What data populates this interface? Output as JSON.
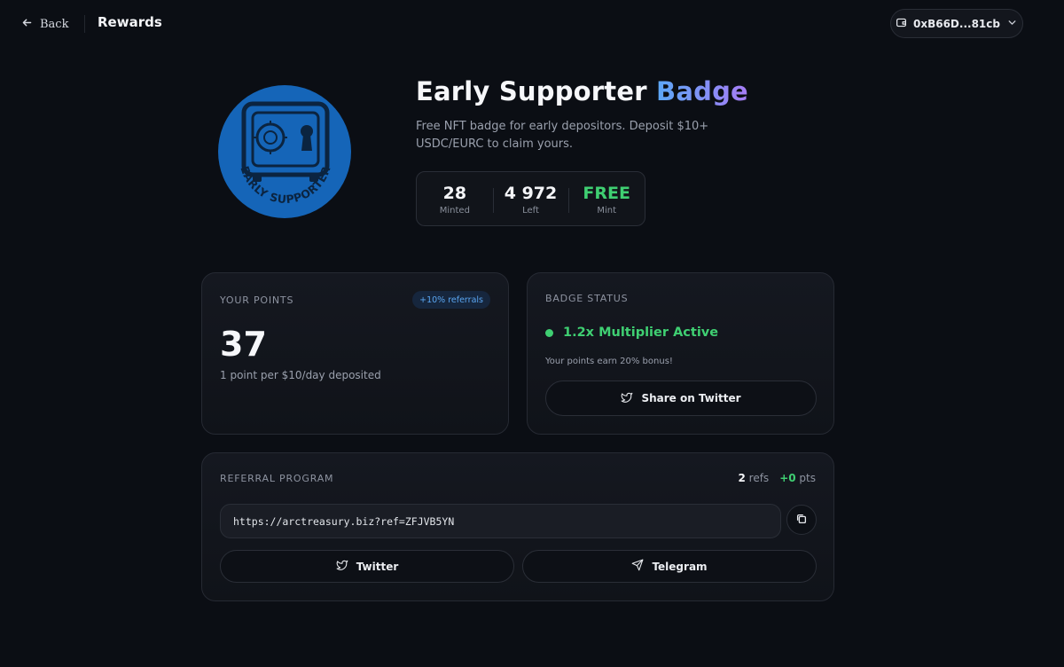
{
  "header": {
    "back_label": "Back",
    "title": "Rewards",
    "wallet_address": "0xB66D...81cb"
  },
  "hero": {
    "title_main": "Early Supporter",
    "title_accent": "Badge",
    "description": "Free NFT badge for early depositors. Deposit $10+ USDC/EURC to claim yours.",
    "badge_text": "EARLY SUPPORTER",
    "stats": [
      {
        "value": "28",
        "label": "Minted"
      },
      {
        "value": "4 972",
        "label": "Left"
      },
      {
        "value": "FREE",
        "label": "Mint"
      }
    ]
  },
  "points": {
    "label": "YOUR POINTS",
    "pill": "+10% referrals",
    "value": "37",
    "subtitle": "1 point per $10/day deposited"
  },
  "badge_status": {
    "label": "BADGE STATUS",
    "active_text": "1.2x Multiplier Active",
    "bonus_text": "Your points earn 20% bonus!",
    "share_label": "Share on Twitter"
  },
  "referral": {
    "label": "REFERRAL PROGRAM",
    "refs_count": "2",
    "refs_label": "refs",
    "pts_value": "+0",
    "pts_label": "pts",
    "link": "https://arctreasury.biz?ref=ZFJVB5YN",
    "twitter_label": "Twitter",
    "telegram_label": "Telegram"
  },
  "colors": {
    "background": "#0b0e14",
    "accent_green": "#3fcf72",
    "accent_blue": "#5aa6f2",
    "badge_blue": "#1565b8"
  }
}
